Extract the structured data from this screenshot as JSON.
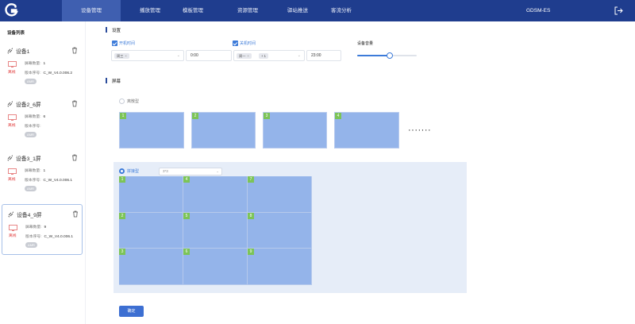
{
  "app": {
    "logo_icon": "g-logo-icon",
    "device_name": "GDSM-ES"
  },
  "nav": {
    "items": [
      {
        "label": "设备管理",
        "active": true
      },
      {
        "label": "播放管理",
        "active": false
      },
      {
        "label": "模板管理",
        "active": false
      },
      {
        "label": "资源管理",
        "active": false
      },
      {
        "label": "驿站推送",
        "active": false
      },
      {
        "label": "客流分析",
        "active": false
      }
    ]
  },
  "sidebar": {
    "title": "设备列表",
    "devices": [
      {
        "name": "设备1",
        "status": "离线",
        "screen_count_label": "屏幕数量:",
        "screen_count": "1",
        "version_label": "版本序号:",
        "version": "C_W_V4.0.006.2",
        "badge": "AMR",
        "selected": false
      },
      {
        "name": "设备2_6屏",
        "status": "离线",
        "screen_count_label": "屏幕数量:",
        "screen_count": "6",
        "version_label": "版本序号:",
        "version": "",
        "badge": "AMR",
        "selected": false
      },
      {
        "name": "设备3_1屏",
        "status": "离线",
        "screen_count_label": "屏幕数量:",
        "screen_count": "1",
        "version_label": "版本序号:",
        "version": "C_W_V4.0.006.1",
        "badge": "AMR",
        "selected": false
      },
      {
        "name": "设备4_9屏",
        "status": "离线",
        "screen_count_label": "屏幕数量:",
        "screen_count": "9",
        "version_label": "版本序号:",
        "version": "C_W_V4.0.006.1",
        "badge": "AMR",
        "selected": true
      }
    ]
  },
  "settings": {
    "title": "设置",
    "power_on": {
      "label": "开机时间",
      "checked": true,
      "day_pill": "周三",
      "time": "0:00"
    },
    "power_off": {
      "label": "关机时间",
      "checked": true,
      "day_pill": "周一",
      "day_pill_extra": "+ 1",
      "time": "23:00"
    },
    "volume": {
      "label": "设备音量",
      "level": 0.55
    }
  },
  "screens": {
    "title": "屏幕",
    "independent": {
      "label": "离散型",
      "selected": false,
      "screens": [
        "1",
        "2",
        "3",
        "4"
      ]
    },
    "more": "·······",
    "splice": {
      "label": "拼接型",
      "selected": true,
      "layout": "3*3",
      "cells": [
        "1",
        "4",
        "7",
        "2",
        "5",
        "8",
        "3",
        "6",
        "9"
      ]
    }
  },
  "actions": {
    "confirm_label": "确定"
  },
  "colors": {
    "nav_bg": "#1f3d8e",
    "accent": "#3d7bd9",
    "screen_fill": "#94b4ea",
    "cell_badge": "#7cc457",
    "offline": "#e03a3a"
  }
}
